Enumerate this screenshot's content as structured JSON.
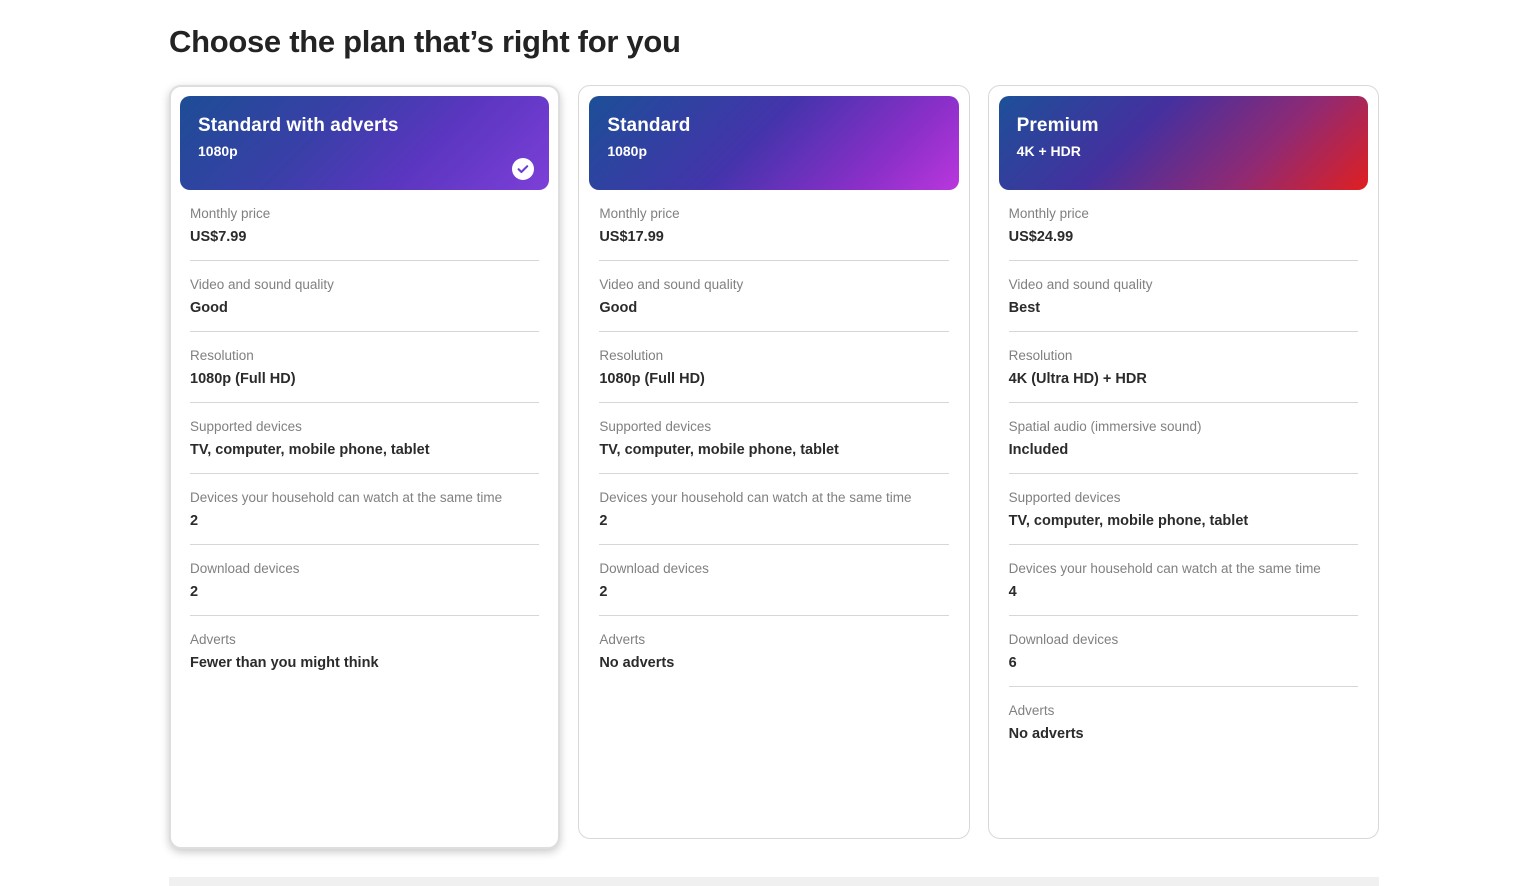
{
  "page": {
    "title": "Choose the plan that’s right for you"
  },
  "icons": {
    "selected_check": "check-circle-icon"
  },
  "colors": {
    "title_text": "#232323",
    "label_text": "#808080",
    "value_text": "#2b2b2b",
    "divider": "#d6d6d6",
    "card_border": "#d8d8d8",
    "selected_border": "#dedede",
    "badge_background": "#ffffff",
    "badge_check": "#6b3fd4",
    "standard_adverts_gradient_start": "#1d4d95",
    "standard_adverts_gradient_end": "#7d3fd8",
    "standard_gradient_start": "#1c4f97",
    "standard_gradient_end": "#ba37dd",
    "premium_gradient_start": "#1d5098",
    "premium_gradient_end": "#e01f20"
  },
  "plans": [
    {
      "name": "Standard with adverts",
      "subtitle": "1080p",
      "selected": true,
      "features": [
        {
          "label": "Monthly price",
          "value": "US$7.99"
        },
        {
          "label": "Video and sound quality",
          "value": "Good"
        },
        {
          "label": "Resolution",
          "value": "1080p (Full HD)"
        },
        {
          "label": "Supported devices",
          "value": "TV, computer, mobile phone, tablet"
        },
        {
          "label": "Devices your household can watch at the same time",
          "value": "2"
        },
        {
          "label": "Download devices",
          "value": "2"
        },
        {
          "label": "Adverts",
          "value": "Fewer than you might think"
        }
      ]
    },
    {
      "name": "Standard",
      "subtitle": "1080p",
      "selected": false,
      "features": [
        {
          "label": "Monthly price",
          "value": "US$17.99"
        },
        {
          "label": "Video and sound quality",
          "value": "Good"
        },
        {
          "label": "Resolution",
          "value": "1080p (Full HD)"
        },
        {
          "label": "Supported devices",
          "value": "TV, computer, mobile phone, tablet"
        },
        {
          "label": "Devices your household can watch at the same time",
          "value": "2"
        },
        {
          "label": "Download devices",
          "value": "2"
        },
        {
          "label": "Adverts",
          "value": "No adverts"
        }
      ]
    },
    {
      "name": "Premium",
      "subtitle": "4K + HDR",
      "selected": false,
      "features": [
        {
          "label": "Monthly price",
          "value": "US$24.99"
        },
        {
          "label": "Video and sound quality",
          "value": "Best"
        },
        {
          "label": "Resolution",
          "value": "4K (Ultra HD) + HDR"
        },
        {
          "label": "Spatial audio (immersive sound)",
          "value": "Included"
        },
        {
          "label": "Supported devices",
          "value": "TV, computer, mobile phone, tablet"
        },
        {
          "label": "Devices your household can watch at the same time",
          "value": "4"
        },
        {
          "label": "Download devices",
          "value": "6"
        },
        {
          "label": "Adverts",
          "value": "No adverts"
        }
      ]
    }
  ]
}
